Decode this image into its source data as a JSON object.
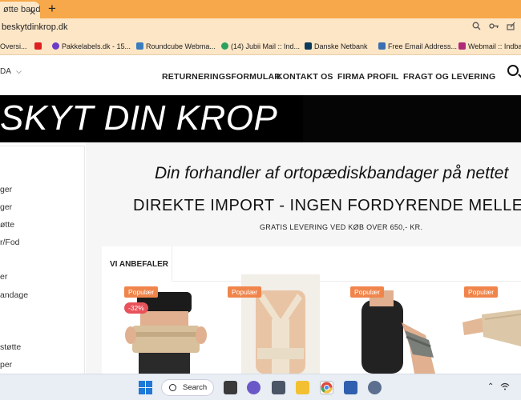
{
  "browser": {
    "tab_title": "øtte band",
    "tab_close": "✕",
    "new_tab": "+",
    "url": "beskytdinkrop.dk",
    "toolbar_icons": [
      "search-icon",
      "key-icon",
      "share-icon"
    ]
  },
  "bookmarks": [
    {
      "label": "Oversi...",
      "color": "#4a7bd1"
    },
    {
      "label": "",
      "color": "#e02020"
    },
    {
      "label": "Pakkelabels.dk - 15...",
      "color": "#6a3cc9"
    },
    {
      "label": "Roundcube Webma...",
      "color": "#3a7dbd"
    },
    {
      "label": "(14) Jubii Mail :: Ind...",
      "color": "#2aa15c"
    },
    {
      "label": "Danske Netbank",
      "color": "#0b3a5c"
    },
    {
      "label": "Free Email Address...",
      "color": "#3a6fb0"
    },
    {
      "label": "Webmail :: Indba",
      "color": "#b02a7a"
    }
  ],
  "site": {
    "lang": "DA",
    "lang_chevron": "⌵",
    "nav": [
      {
        "label": "RETURNERINGSFORMULAR"
      },
      {
        "label": "KONTAKT OS"
      },
      {
        "label": "FIRMA PROFIL"
      },
      {
        "label": "FRAGT OG LEVERING"
      }
    ],
    "banner_text": "SKYT DIN KROP"
  },
  "sidebar": {
    "items": [
      "ger",
      "ger",
      "øtte",
      "r/Fod",
      "er",
      "andage",
      "støtte",
      "per"
    ]
  },
  "main": {
    "tagline": "Din forhandler af  ortopædiskbandager  på nettet",
    "import_text": "DIREKTE IMPORT - INGEN FORDYRENDE MELLEML",
    "shipping_text": "GRATIS LEVERING VED KØB OVER 650,- KR.",
    "recommend_tab": "VI ANBEFALER",
    "products": [
      {
        "badge": "Populær",
        "discount": "-32%"
      },
      {
        "badge": "Populær"
      },
      {
        "badge": "Populær"
      },
      {
        "badge": "Populær"
      }
    ]
  },
  "taskbar": {
    "search_label": "Search"
  },
  "colors": {
    "tab_strip": "#f7a84a",
    "toolbar": "#fde6c6",
    "badge": "#f0854b",
    "discount": "#e8525a"
  }
}
